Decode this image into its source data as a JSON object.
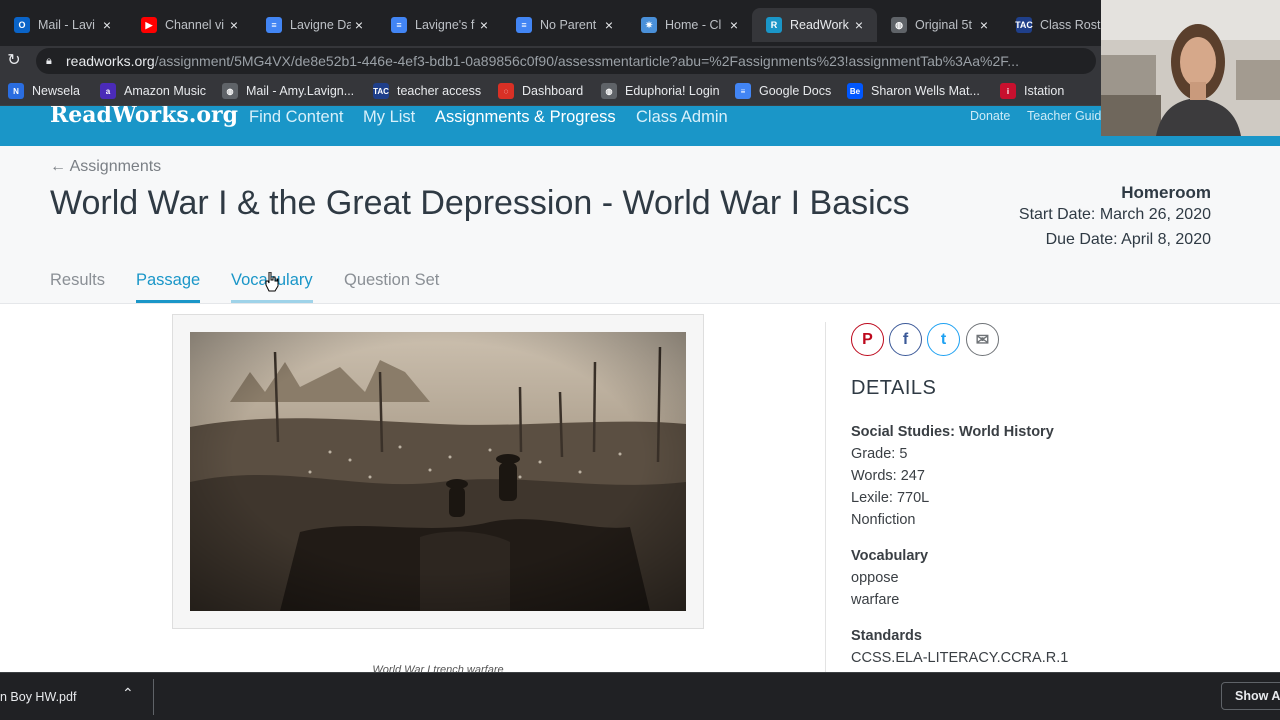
{
  "browser": {
    "tabs": [
      {
        "title": "Mail - Lavi",
        "icon": "outlook-icon",
        "color": "#0a64c8",
        "glyph": "O"
      },
      {
        "title": "Channel vi",
        "icon": "youtube-icon",
        "color": "#ff0000",
        "glyph": "▶"
      },
      {
        "title": "Lavigne Da",
        "icon": "docs-icon",
        "color": "#4285f4",
        "glyph": "≡"
      },
      {
        "title": "Lavigne's f",
        "icon": "docs-icon",
        "color": "#4285f4",
        "glyph": "≡"
      },
      {
        "title": "No Parent",
        "icon": "docs-icon",
        "color": "#4285f4",
        "glyph": "≡"
      },
      {
        "title": "Home - Cl",
        "icon": "clever-icon",
        "color": "#4a90d9",
        "glyph": "✷"
      },
      {
        "title": "ReadWork",
        "icon": "readworks-icon",
        "color": "#1a96c8",
        "glyph": "R"
      },
      {
        "title": "Original 5t",
        "icon": "globe-icon",
        "color": "#5f6368",
        "glyph": "◍"
      },
      {
        "title": "Class Rost",
        "icon": "tac-icon",
        "color": "#1f3f8a",
        "glyph": "TAC"
      }
    ],
    "url_host": "readworks.org",
    "url_path": "/assignment/5MG4VX/de8e52b1-446e-4ef3-bdb1-0a89856c0f90/assessmentarticle?abu=%2Fassignments%23!assignmentTab%3Aa%2F...",
    "bookmarks": [
      {
        "label": "Newsela",
        "icon": "newsela-icon",
        "color": "#2a6de0",
        "glyph": "N"
      },
      {
        "label": "Amazon Music",
        "icon": "amazon-music-icon",
        "color": "#4b2bb8",
        "glyph": "a"
      },
      {
        "label": "Mail - Amy.Lavign...",
        "icon": "globe-icon",
        "color": "#5f6368",
        "glyph": "◍"
      },
      {
        "label": "teacher access",
        "icon": "tac-icon",
        "color": "#1f3f8a",
        "glyph": "TAC"
      },
      {
        "label": "Dashboard",
        "icon": "dashboard-icon",
        "color": "#d93025",
        "glyph": "◌"
      },
      {
        "label": "Eduphoria! Login",
        "icon": "globe-icon",
        "color": "#5f6368",
        "glyph": "◍"
      },
      {
        "label": "Google Docs",
        "icon": "docs-icon",
        "color": "#4285f4",
        "glyph": "≡"
      },
      {
        "label": "Sharon Wells Mat...",
        "icon": "behance-icon",
        "color": "#0057ff",
        "glyph": "Be"
      },
      {
        "label": "Istation",
        "icon": "istation-icon",
        "color": "#c8102e",
        "glyph": "i"
      }
    ]
  },
  "site": {
    "logo": "ReadWorks.org",
    "nav": [
      "Find Content",
      "My List",
      "Assignments & Progress",
      "Class Admin"
    ],
    "donate": "Donate",
    "teacher_guide": "Teacher Guid"
  },
  "assignment": {
    "back_link": "← Assignments",
    "title": "World War I & the Great Depression - World War I Basics",
    "class_name": "Homeroom",
    "start_date": "Start Date: March 26, 2020",
    "due_date": "Due Date: April 8, 2020",
    "tabs": [
      "Results",
      "Passage",
      "Vocabulary",
      "Question Set"
    ]
  },
  "passage": {
    "caption": "World War I trench warfare"
  },
  "details": {
    "heading": "DETAILS",
    "subject": "Social Studies: World History",
    "grade": "Grade: 5",
    "words": "Words: 247",
    "lexile": "Lexile: 770L",
    "genre": "Nonfiction",
    "vocab_heading": "Vocabulary",
    "vocab_words": [
      "oppose",
      "warfare"
    ],
    "standards_heading": "Standards",
    "standards": [
      "CCSS.ELA-LITERACY.CCRA.R.1"
    ],
    "share_colors": {
      "pinterest": "#bd081c",
      "facebook": "#3b5998",
      "twitter": "#1da1f2",
      "email": "#6f7377"
    }
  },
  "downloads": {
    "file": "n Boy HW.pdf",
    "show_all": "Show All"
  }
}
